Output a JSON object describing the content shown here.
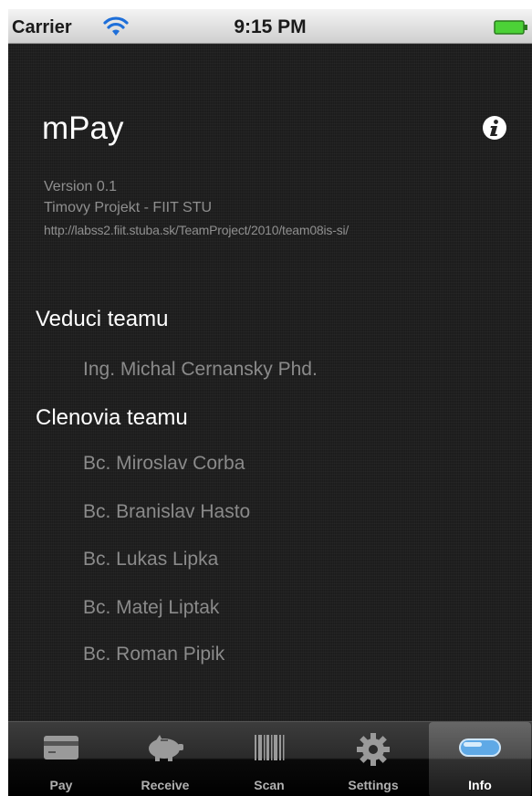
{
  "status_bar": {
    "carrier": "Carrier",
    "time": "9:15 PM"
  },
  "header": {
    "title": "mPay",
    "info_icon": "info-icon"
  },
  "meta": {
    "version": "Version 0.1",
    "project": "Timovy Projekt - FIIT STU",
    "url": "http://labss2.fiit.stuba.sk/TeamProject/2010/team08is-si/"
  },
  "leader_section": {
    "title": "Veduci teamu",
    "members": [
      "Ing. Michal Cernansky Phd."
    ]
  },
  "members_section": {
    "title": "Clenovia teamu",
    "members": [
      "Bc. Miroslav Corba",
      "Bc. Branislav Hasto",
      "Bc. Lukas Lipka",
      "Bc. Matej Liptak",
      "Bc. Roman Pipik"
    ]
  },
  "tabs": [
    {
      "label": "Pay",
      "icon": "card-icon"
    },
    {
      "label": "Receive",
      "icon": "piggy-bank-icon"
    },
    {
      "label": "Scan",
      "icon": "barcode-icon"
    },
    {
      "label": "Settings",
      "icon": "gear-icon"
    },
    {
      "label": "Info",
      "icon": "pill-icon",
      "selected": true
    }
  ],
  "colors": {
    "background": "#212121",
    "accent": "#5fa9e6",
    "battery": "#4cd137"
  }
}
